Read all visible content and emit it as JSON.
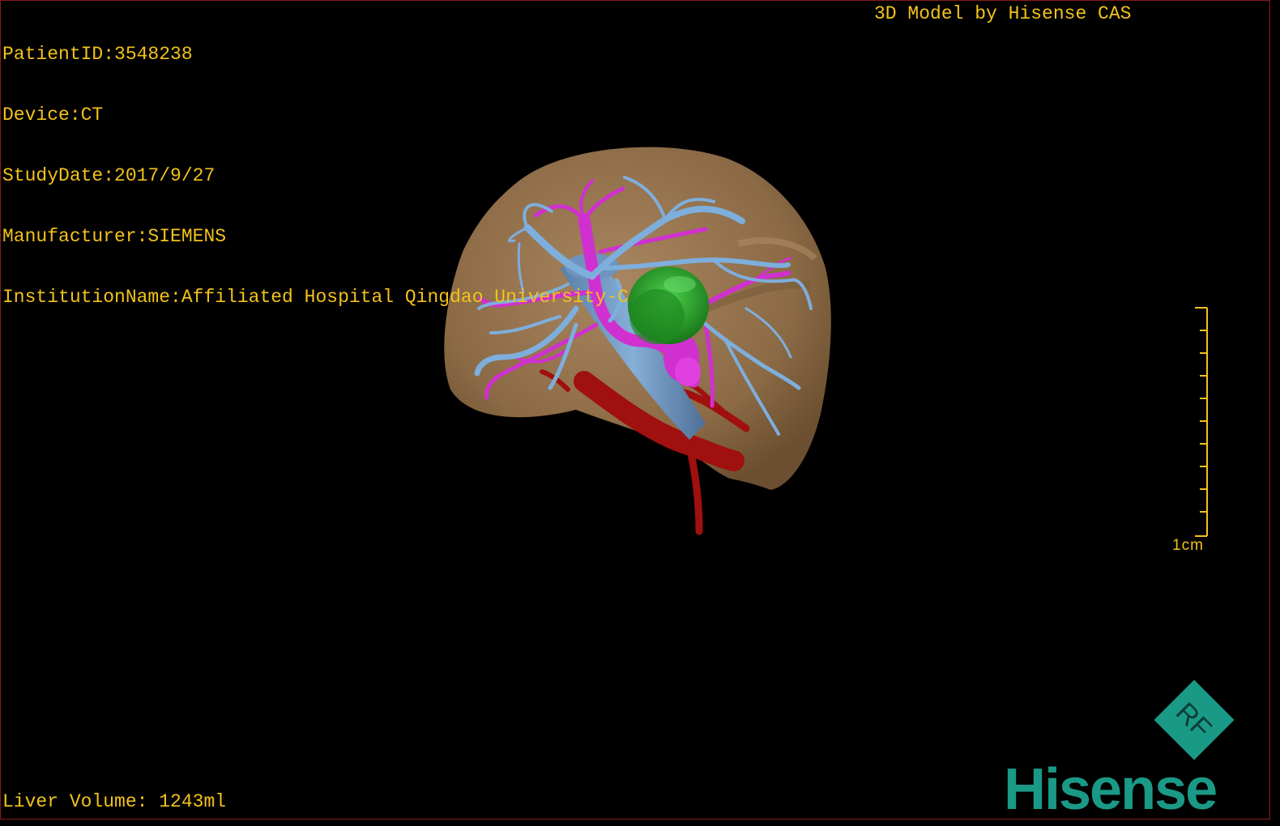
{
  "info": {
    "patient_id": "PatientID:3548238",
    "device": "Device:CT",
    "study_date": "StudyDate:2017/9/27",
    "manufacturer": "Manufacturer:SIEMENS",
    "institution": "InstitutionName:Affiliated Hospital Qingdao University-C"
  },
  "credit": "3D Model by Hisense CAS",
  "liver_volume": "Liver Volume: 1243ml",
  "scale": {
    "label": "1cm"
  },
  "badge": {
    "text": "RF"
  },
  "brand": {
    "text": "Hisense",
    "color": "#1a9986"
  },
  "colors": {
    "overlay_text": "#f2c21b",
    "liver": "#8b6a45",
    "hepatic_vein": "#7eaedc",
    "portal_vein": "#d030d0",
    "artery": "#a0100f",
    "lesion": "#2aa030",
    "border": "#8a1a1a"
  }
}
